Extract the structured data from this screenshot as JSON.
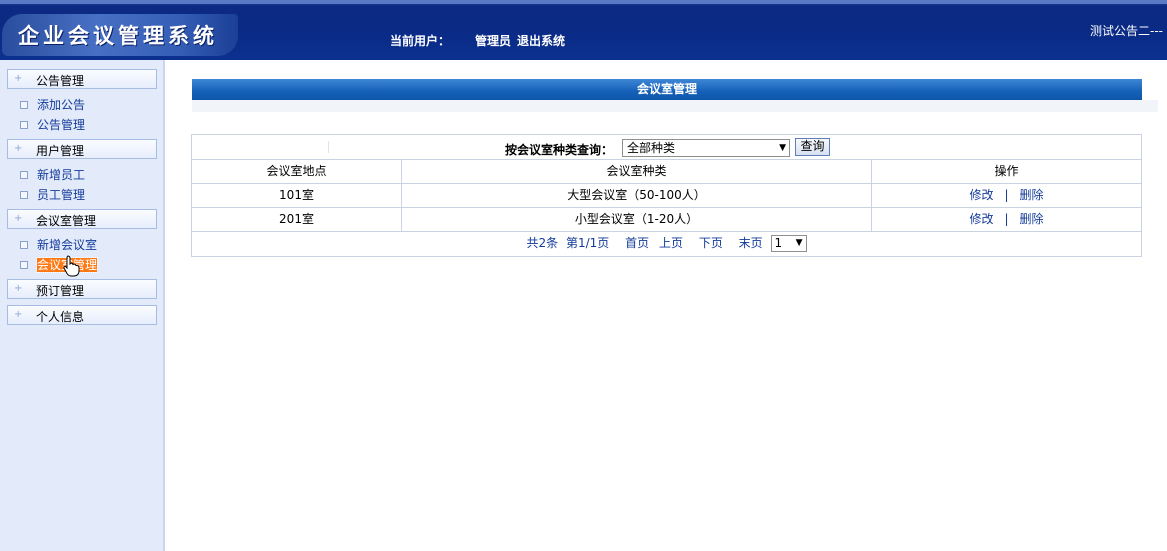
{
  "header": {
    "system_title": "企业会议管理系统",
    "current_user_label": "当前用户：",
    "current_user": "管理员",
    "logout_label": "退出系统",
    "marquee": "测试公告二---"
  },
  "sidebar": {
    "groups": [
      {
        "label": "公告管理",
        "items": [
          "添加公告",
          "公告管理"
        ]
      },
      {
        "label": "用户管理",
        "items": [
          "新增员工",
          "员工管理"
        ]
      },
      {
        "label": "会议室管理",
        "items": [
          "新增会议室",
          "会议室管理"
        ]
      },
      {
        "label": "预订管理",
        "items": []
      },
      {
        "label": "个人信息",
        "items": []
      }
    ],
    "active_item": "会议室管理"
  },
  "main": {
    "title": "会议室管理",
    "query": {
      "label": "按会议室种类查询：",
      "selected": "全部种类",
      "button": "查询"
    },
    "table": {
      "columns": [
        "会议室地点",
        "会议室种类",
        "操作"
      ],
      "rows": [
        {
          "location": "101室",
          "type": "大型会议室（50-100人）",
          "edit": "修改",
          "sep": "|",
          "delete": "删除"
        },
        {
          "location": "201室",
          "type": "小型会议室（1-20人）",
          "edit": "修改",
          "sep": "|",
          "delete": "删除"
        }
      ]
    },
    "pager": {
      "total": "共2条",
      "page_info": "第1/1页",
      "first": "首页",
      "prev": "上页",
      "next": "下页",
      "last": "末页",
      "page_selected": "1"
    }
  },
  "colors": {
    "header_bg": "#0a2a85",
    "title_bar": "#1560b8",
    "sidebar_bg": "#e3ebfa",
    "link": "#133b9a",
    "active_highlight": "#ff7a14"
  }
}
